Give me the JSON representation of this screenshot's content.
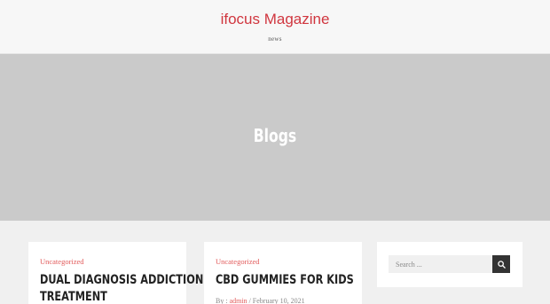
{
  "header": {
    "site_title": "ifocus Magazine",
    "tagline": "news"
  },
  "hero": {
    "title": "Blogs"
  },
  "posts": [
    {
      "category": "Uncategorized",
      "title_line1": "DUAL DIAGNOSIS ADDICTION",
      "title_line2": "TREATMENT"
    },
    {
      "category": "Uncategorized",
      "title_line1": "CBD GUMMIES FOR KIDS",
      "meta_by": "By : ",
      "meta_author": "admin",
      "meta_sep": " / ",
      "meta_date": "February 10, 2021"
    }
  ],
  "sidebar": {
    "search_placeholder": "Search ..."
  },
  "colors": {
    "accent": "#d0363f",
    "category": "#e25b5b",
    "hero_bg": "#cacaca",
    "search_button": "#333333"
  },
  "icons": {
    "search_button_icon": "search-icon"
  }
}
